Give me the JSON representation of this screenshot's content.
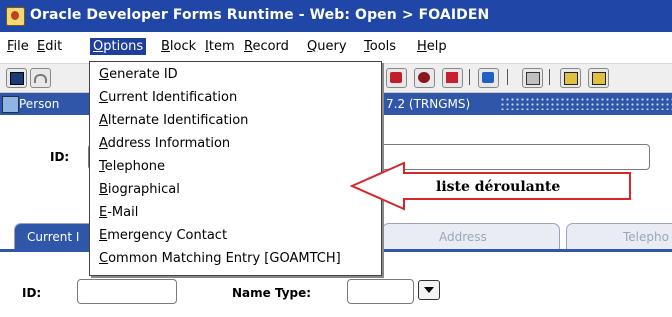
{
  "window": {
    "title": "Oracle Developer Forms Runtime - Web:  Open > FOAIDEN"
  },
  "menubar": {
    "items": [
      {
        "key": "F",
        "rest": "ile"
      },
      {
        "key": "E",
        "rest": "dit"
      },
      {
        "key": "O",
        "rest": "ptions"
      },
      {
        "key": "B",
        "rest": "lock"
      },
      {
        "key": "I",
        "rest": "tem"
      },
      {
        "key": "R",
        "rest": "ecord"
      },
      {
        "key": "Q",
        "rest": "uery"
      },
      {
        "key": "T",
        "rest": "ools"
      },
      {
        "key": "H",
        "rest": "elp"
      }
    ]
  },
  "form_window": {
    "title_left": "Person",
    "title_right": "7.2 (TRNGMS)"
  },
  "key_block": {
    "id_label": "ID:"
  },
  "tabs": [
    {
      "label": "Current I",
      "active": true
    },
    {
      "label": "Address",
      "active": false
    },
    {
      "label": "Telepho",
      "active": false
    }
  ],
  "current_tab": {
    "id_label": "ID:",
    "name_type_label": "Name Type:"
  },
  "options_menu": {
    "items": [
      {
        "key": "G",
        "rest": "enerate ID"
      },
      {
        "key": "C",
        "rest": "urrent Identification"
      },
      {
        "key": "A",
        "rest": "lternate Identification"
      },
      {
        "key": "A",
        "rest": "ddress Information"
      },
      {
        "key": "T",
        "rest": "elephone"
      },
      {
        "key": "B",
        "rest": "iographical"
      },
      {
        "key": "E",
        "rest": "-Mail"
      },
      {
        "key": "E",
        "rest": "mergency Contact"
      },
      {
        "key": "C",
        "rest": "ommon Matching Entry [GOAMTCH]"
      }
    ]
  },
  "annotation": {
    "text": "liste déroulante",
    "color": "#d8262a"
  },
  "colors": {
    "title_bar": "#2047a8",
    "menu_highlight": "#1f3f9e",
    "window_header": "#2f56a8"
  },
  "toolbar_icons": [
    "save-icon",
    "rollback-icon",
    "help-icon",
    "block-icon",
    "exit-icon",
    "previous-record-icon",
    "print-icon",
    "x-button-icon",
    "x-button-icon"
  ]
}
